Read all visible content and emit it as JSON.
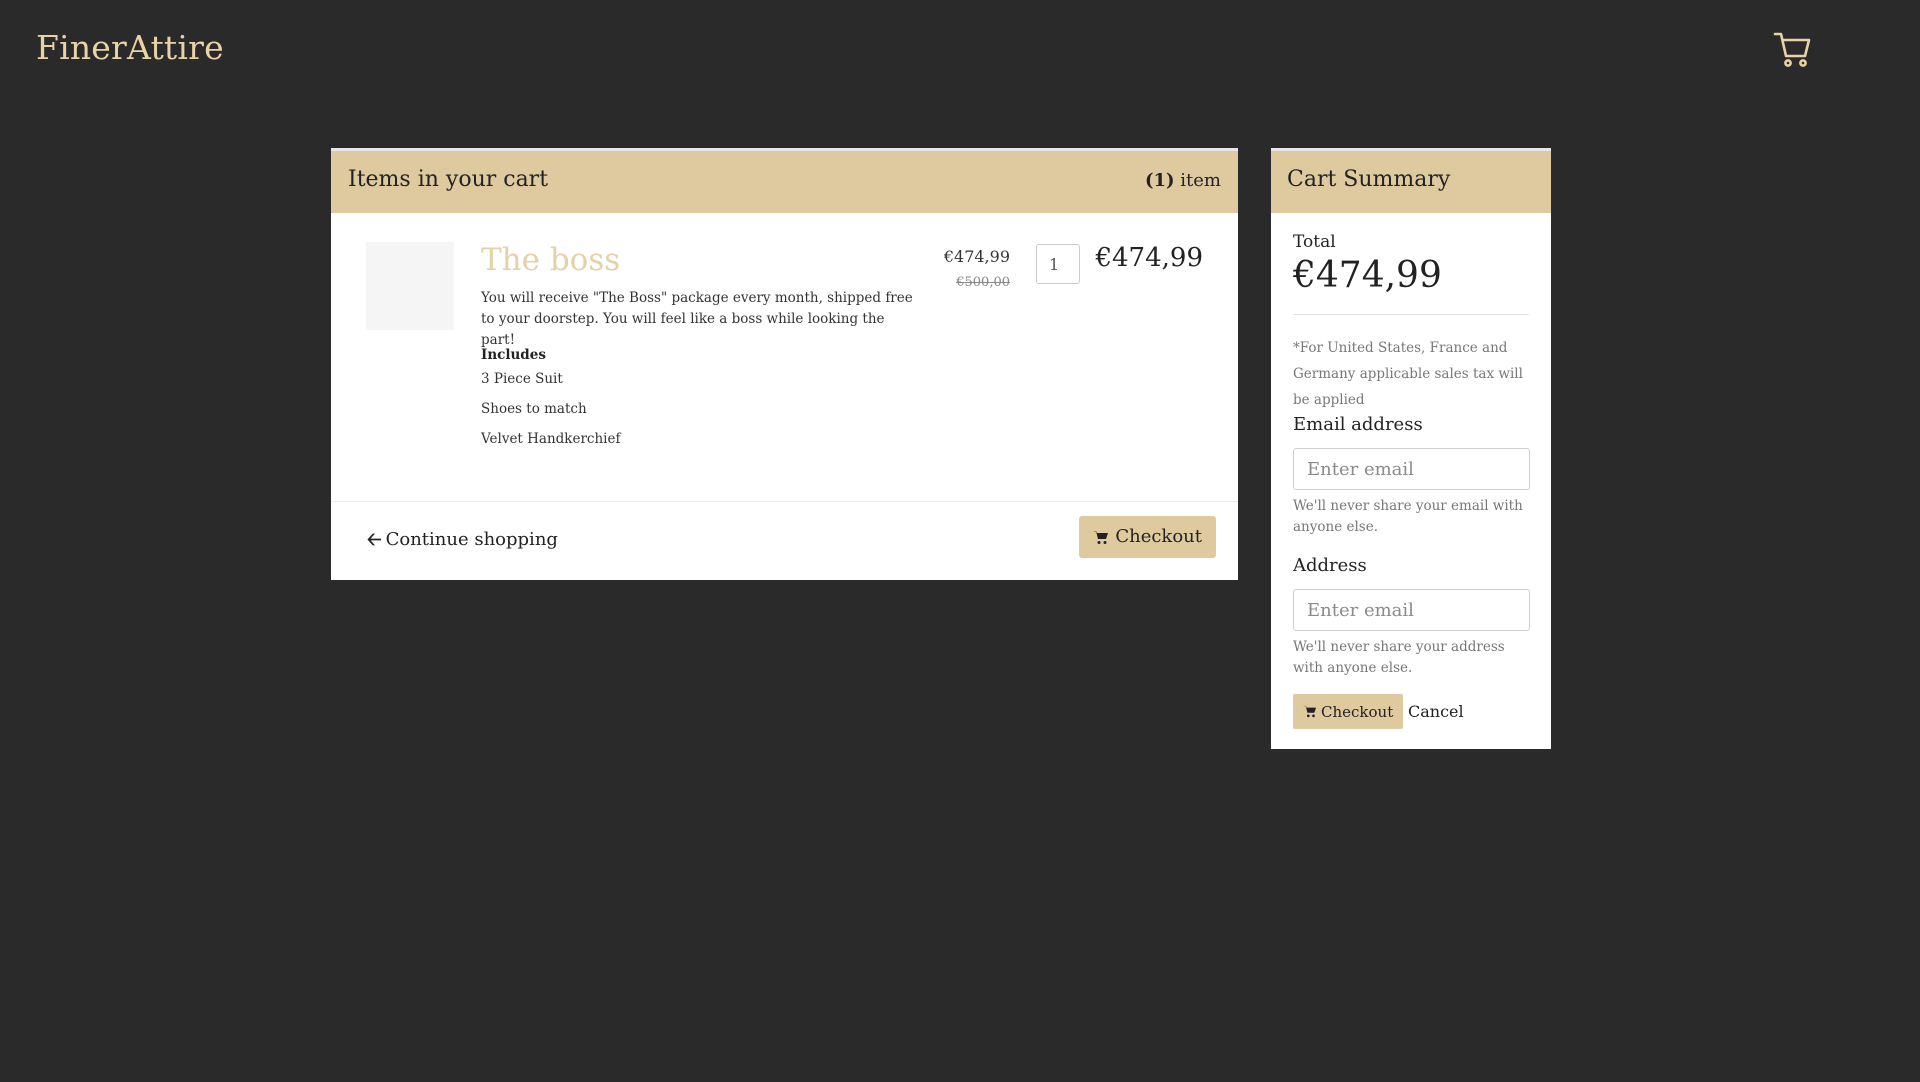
{
  "navbar": {
    "brand": "FinerAttire",
    "cart_icon": "shopping-cart-icon"
  },
  "cart": {
    "title": "Items in your cart",
    "count_number": "(1)",
    "count_label": " item",
    "items": [
      {
        "name": "The boss",
        "description": "You will receive \"The Boss\" package every month, shipped free to your doorstep. You will feel like a boss while looking the part!",
        "includes_title": "Includes",
        "includes": [
          "3 Piece Suit",
          "Shoes to match",
          "Velvet Handkerchief"
        ],
        "unit_price": "€474,99",
        "old_price": "€500,00",
        "quantity": "1",
        "line_total": "€474,99"
      }
    ],
    "continue_label": "Continue shopping",
    "checkout_label": "Checkout"
  },
  "summary": {
    "title": "Cart Summary",
    "total_label": "Total",
    "total_value": "€474,99",
    "tax_note": "*For United States, France and Germany applicable sales tax will be applied",
    "email_label": "Email address",
    "email_placeholder": "Enter email",
    "email_help": "We'll never share your email with anyone else.",
    "address_label": "Address",
    "address_placeholder": "Enter email",
    "address_help": "We'll never share your address with anyone else.",
    "checkout_label": "Checkout",
    "cancel_label": "Cancel"
  },
  "colors": {
    "background": "#2a2a2a",
    "accent": "#dfca9f",
    "brand": "#e8d3a6"
  }
}
